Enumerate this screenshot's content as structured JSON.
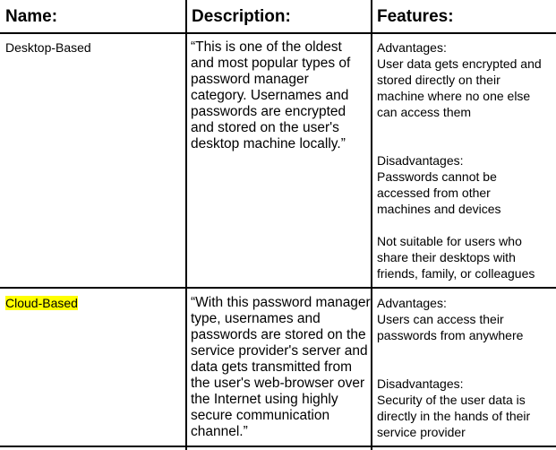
{
  "table": {
    "headers": [
      "Name:",
      "Description:",
      "Features:"
    ],
    "rows": [
      {
        "name": "Desktop-Based",
        "name_highlight": false,
        "description_lines": [
          "“This is one of the oldest",
          "and most popular types of",
          "password manager",
          "category. Usernames and",
          "passwords are encrypted",
          "and stored on the user's",
          "desktop machine locally.”"
        ],
        "features": {
          "advantages_label": "Advantages:",
          "advantages_lines": [
            "User data gets encrypted and",
            "stored directly on their",
            "machine where no one else",
            "can access them"
          ],
          "disadvantages_label": "Disadvantages:",
          "disadvantages_lines": [
            "Passwords cannot be",
            "accessed from other",
            "machines and devices"
          ],
          "extra_lines": [
            "Not suitable for users who",
            "share their desktops with",
            "friends, family, or colleagues"
          ]
        }
      },
      {
        "name": "Cloud-Based",
        "name_highlight": true,
        "highlight_color": "#ffff00",
        "description_lines": [
          "“With this password manager",
          "type, usernames and",
          "passwords are stored on the",
          "service provider's server and",
          "data gets transmitted from",
          "the user's web-browser over",
          "the Internet using highly",
          "secure communication",
          "channel.”"
        ],
        "features": {
          "advantages_label": "Advantages:",
          "advantages_lines": [
            "Users can access their",
            "passwords from anywhere"
          ],
          "disadvantages_label": "Disadvantages:",
          "disadvantages_lines": [
            "Security of the user data is",
            "directly in the hands of their",
            "service provider"
          ]
        }
      }
    ]
  }
}
